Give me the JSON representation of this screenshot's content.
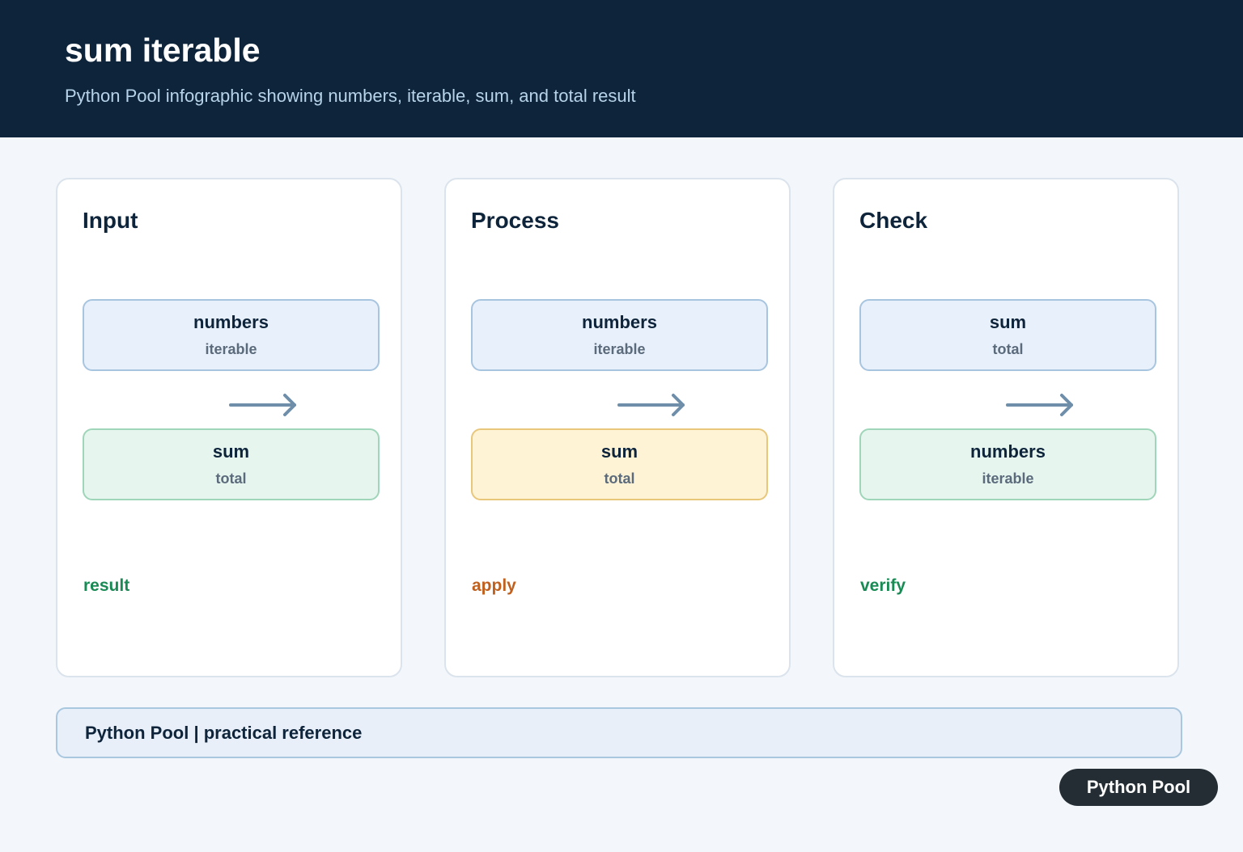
{
  "header": {
    "title": "sum iterable",
    "subtitle": "Python Pool infographic showing numbers, iterable, sum, and total result"
  },
  "panels": [
    {
      "title": "Input",
      "top_box": {
        "main": "numbers",
        "sub": "iterable",
        "fill": "#e8f0fb",
        "border": "#a8c5e0"
      },
      "bottom_box": {
        "main": "sum",
        "sub": "total",
        "fill": "#e6f5ee",
        "border": "#9fd5b9"
      },
      "label": "result",
      "label_color": "#1a8a55"
    },
    {
      "title": "Process",
      "top_box": {
        "main": "numbers",
        "sub": "iterable",
        "fill": "#e8f0fb",
        "border": "#a8c5e0"
      },
      "bottom_box": {
        "main": "sum",
        "sub": "total",
        "fill": "#fff3d6",
        "border": "#e8c77a"
      },
      "label": "apply",
      "label_color": "#c0601f"
    },
    {
      "title": "Check",
      "top_box": {
        "main": "sum",
        "sub": "total",
        "fill": "#e8f0fb",
        "border": "#a8c5e0"
      },
      "bottom_box": {
        "main": "numbers",
        "sub": "iterable",
        "fill": "#e6f5ee",
        "border": "#9fd5b9"
      },
      "label": "verify",
      "label_color": "#1a8a55"
    }
  ],
  "arrow_color": "#6e8eaa",
  "footer": {
    "text": "Python Pool | practical reference"
  },
  "brand": {
    "label": "Python Pool"
  }
}
